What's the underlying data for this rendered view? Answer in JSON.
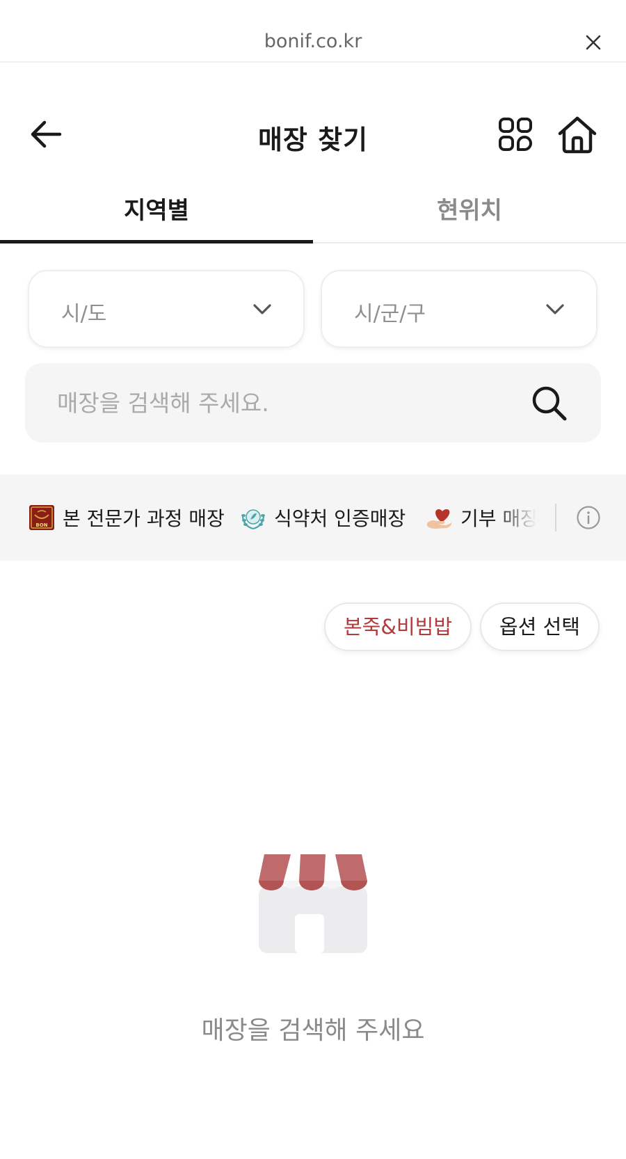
{
  "browser": {
    "url": "bonif.co.kr",
    "close_icon": "close-icon"
  },
  "header": {
    "title": "매장 찾기",
    "back_icon": "arrow-left-icon",
    "menu_icon": "grid-menu-icon",
    "home_icon": "home-icon"
  },
  "tabs": [
    {
      "label": "지역별",
      "active": true
    },
    {
      "label": "현위치",
      "active": false
    }
  ],
  "filters": {
    "sido": {
      "label": "시/도",
      "icon": "chevron-down-icon"
    },
    "sigungu": {
      "label": "시/군/구",
      "icon": "chevron-down-icon"
    }
  },
  "search": {
    "placeholder": "매장을 검색해 주세요.",
    "icon": "search-icon"
  },
  "legend": {
    "items": [
      {
        "label": "본 전문가 과정 매장",
        "icon": "bon-expert-badge-icon",
        "badge_text": "BON"
      },
      {
        "label": "식약처 인증매장",
        "icon": "laurel-certified-icon"
      },
      {
        "label": "기부 매장",
        "icon": "heart-hand-icon"
      }
    ],
    "info_icon": "info-icon"
  },
  "chips": {
    "brand": "본죽&비빔밥",
    "option": "옵션 선택"
  },
  "empty_state": {
    "icon": "store-icon",
    "message": "매장을 검색해 주세요"
  },
  "colors": {
    "accent": "#b23a3a",
    "awning": "#c06b6b",
    "text_primary": "#1a1a1a",
    "text_muted": "#8a8a8a",
    "surface": "#f5f5f5"
  }
}
